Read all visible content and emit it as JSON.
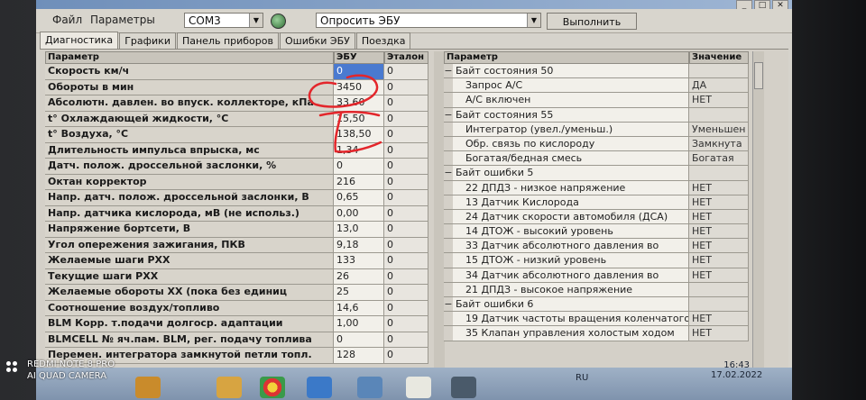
{
  "window": {
    "title": ""
  },
  "menu": {
    "file": "Файл",
    "params": "Параметры",
    "port": "COM3",
    "action": "Опросить ЭБУ",
    "execute": "Выполнить"
  },
  "tabs": [
    "Диагностика",
    "Графики",
    "Панель приборов",
    "Ошибки ЭБУ",
    "Поездка"
  ],
  "left_table": {
    "headers": {
      "param": "Параметр",
      "ecu": "ЭБУ",
      "ref": "Эталон"
    },
    "rows": [
      {
        "name": "Скорость км/ч",
        "ecu": "0",
        "ref": "0"
      },
      {
        "name": "Обороты в мин",
        "ecu": "3450",
        "ref": "0"
      },
      {
        "name": "Абсолютн. давлен. во впуск. коллекторе, кПа",
        "ecu": "33,60",
        "ref": "0"
      },
      {
        "name": "t° Охлаждающей жидкости, °С",
        "ecu": "15,50",
        "ref": "0"
      },
      {
        "name": "t° Воздуха, °С",
        "ecu": "138,50",
        "ref": "0"
      },
      {
        "name": "Длительность импульса впрыска, мс",
        "ecu": "1,34",
        "ref": "0"
      },
      {
        "name": "Датч. полож. дроссельной заслонки, %",
        "ecu": "0",
        "ref": "0"
      },
      {
        "name": "Октан корректор",
        "ecu": "216",
        "ref": "0"
      },
      {
        "name": "Напр. датч. полож. дроссельной заслонки, В",
        "ecu": "0,65",
        "ref": "0"
      },
      {
        "name": "Напр. датчика кислорода, мВ (не использ.)",
        "ecu": "0,00",
        "ref": "0"
      },
      {
        "name": "Напряжение бортсети, В",
        "ecu": "13,0",
        "ref": "0"
      },
      {
        "name": "Угол опережения зажигания, ПКВ",
        "ecu": "9,18",
        "ref": "0"
      },
      {
        "name": "Желаемые шаги РХХ",
        "ecu": "133",
        "ref": "0"
      },
      {
        "name": "Текущие шаги РХХ",
        "ecu": "26",
        "ref": "0"
      },
      {
        "name": "Желаемые обороты ХХ (пока без единиц",
        "ecu": "25",
        "ref": "0"
      },
      {
        "name": "Соотношение воздух/топливо",
        "ecu": "14,6",
        "ref": "0"
      },
      {
        "name": "BLM Корр. т.подачи долгоср. адаптации",
        "ecu": "1,00",
        "ref": "0"
      },
      {
        "name": "BLMCELL № яч.пам. BLM, рег. подачу топлива",
        "ecu": "0",
        "ref": "0"
      },
      {
        "name": "Перемен. интегратора замкнутой петли топл.",
        "ecu": "128",
        "ref": "0"
      }
    ]
  },
  "right_table": {
    "headers": {
      "param": "Параметр",
      "value": "Значение"
    },
    "rows": [
      {
        "kind": "group",
        "exp": "−",
        "name": "Байт состояния 50",
        "value": ""
      },
      {
        "kind": "sub",
        "exp": "",
        "name": "Запрос А/С",
        "value": "ДА"
      },
      {
        "kind": "sub",
        "exp": "",
        "name": "А/С включен",
        "value": "НЕТ"
      },
      {
        "kind": "group",
        "exp": "−",
        "name": "Байт состояния 55",
        "value": ""
      },
      {
        "kind": "sub",
        "exp": "",
        "name": "Интегратор (увел./уменьш.)",
        "value": "Уменьшен"
      },
      {
        "kind": "sub",
        "exp": "",
        "name": "Обр. связь по кислороду",
        "value": "Замкнута"
      },
      {
        "kind": "sub",
        "exp": "",
        "name": "Богатая/бедная смесь",
        "value": "Богатая"
      },
      {
        "kind": "group",
        "exp": "−",
        "name": "Байт ошибки 5",
        "value": ""
      },
      {
        "kind": "sub",
        "exp": "",
        "name": "22 ДПДЗ - низкое напряжение",
        "value": "НЕТ"
      },
      {
        "kind": "sub",
        "exp": "",
        "name": "13 Датчик Кислорода",
        "value": "НЕТ"
      },
      {
        "kind": "sub",
        "exp": "",
        "name": "24 Датчик скорости автомобиля (ДСА)",
        "value": "НЕТ"
      },
      {
        "kind": "sub",
        "exp": "",
        "name": "14 ДТОЖ - высокий уровень",
        "value": "НЕТ"
      },
      {
        "kind": "sub",
        "exp": "",
        "name": "33 Датчик абсолютного давления во",
        "value": "НЕТ"
      },
      {
        "kind": "sub",
        "exp": "",
        "name": "15 ДТОЖ - низкий уровень",
        "value": "НЕТ"
      },
      {
        "kind": "sub",
        "exp": "",
        "name": "34 Датчик абсолютного давления во",
        "value": "НЕТ"
      },
      {
        "kind": "sub",
        "exp": "",
        "name": "21 ДПДЗ - высокое напряжение",
        "value": ""
      },
      {
        "kind": "group",
        "exp": "−",
        "name": "Байт ошибки 6",
        "value": ""
      },
      {
        "kind": "sub",
        "exp": "",
        "name": "19 Датчик частоты вращения коленчатого",
        "value": "НЕТ"
      },
      {
        "kind": "sub",
        "exp": "",
        "name": "35 Клапан управления холостым ходом",
        "value": "НЕТ"
      }
    ]
  },
  "taskbar": {
    "lang": "RU",
    "time": "16:43",
    "date": "17.02.2022"
  },
  "watermark": {
    "line1": "REDMI NOTE 8 PRO",
    "line2": "AI QUAD CAMERA"
  }
}
